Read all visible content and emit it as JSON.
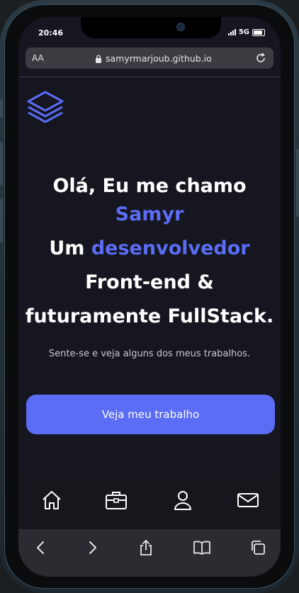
{
  "status": {
    "time": "20:46",
    "network": "5G"
  },
  "browser": {
    "text_size_label": "AA",
    "url": "samyrmarjoub.github.io"
  },
  "hero": {
    "line1": "Olá, Eu me chamo",
    "name": "Samyr",
    "line3_prefix": "Um",
    "line3_accent": "desenvolvedor",
    "line4": "Front-end &",
    "line5": "futuramente FullStack.",
    "subtitle": "Sente-se e veja alguns dos meus trabalhos.",
    "cta_label": "Veja meu trabalho"
  },
  "bottom_nav": {
    "items": [
      "home-icon",
      "briefcase-icon",
      "user-icon",
      "mail-icon"
    ]
  },
  "safari_toolbar": {
    "items": [
      "back-icon",
      "forward-icon",
      "share-icon",
      "bookmarks-icon",
      "tabs-icon"
    ]
  },
  "colors": {
    "accent": "#5b6cf5",
    "background": "#15161f",
    "text": "#ffffff"
  }
}
